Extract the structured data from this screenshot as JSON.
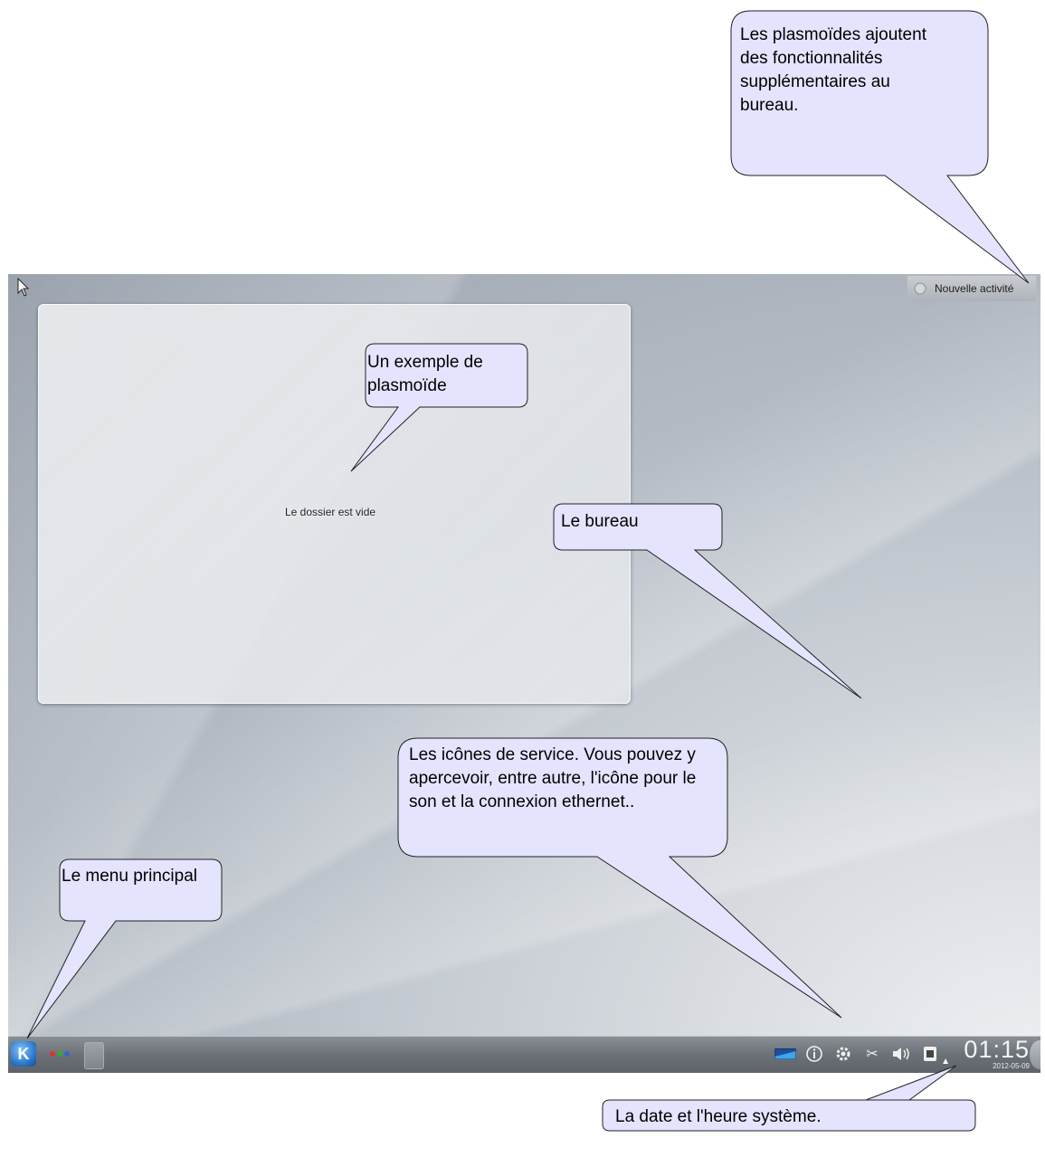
{
  "desktop": {
    "folder_view": {
      "empty_text": "Le dossier est vide"
    },
    "activity_button": {
      "label": "Nouvelle activité"
    },
    "panel": {
      "kmenu_label": "K",
      "clock": {
        "time": "01:15",
        "date": "2012-05-09"
      },
      "tray_icons": [
        "network-icon",
        "info-icon",
        "settings-icon",
        "scissors-icon",
        "speaker-icon",
        "ethernet-icon"
      ]
    }
  },
  "callouts": {
    "plasmoids": "Les plasmoïdes ajoutent des fonctionnalités supplémentaires au bureau.",
    "example": "Un exemple de plasmoïde",
    "desktop": "Le bureau",
    "services": "Les icônes de service.  Vous pouvez y apercevoir, entre autre, l'icône pour le son et la connexion ethernet..",
    "menu": "Le menu principal",
    "datetime": "La date et l'heure système."
  },
  "colors": {
    "callout_fill": "#e4e4ff",
    "panel": "#6c7178"
  }
}
